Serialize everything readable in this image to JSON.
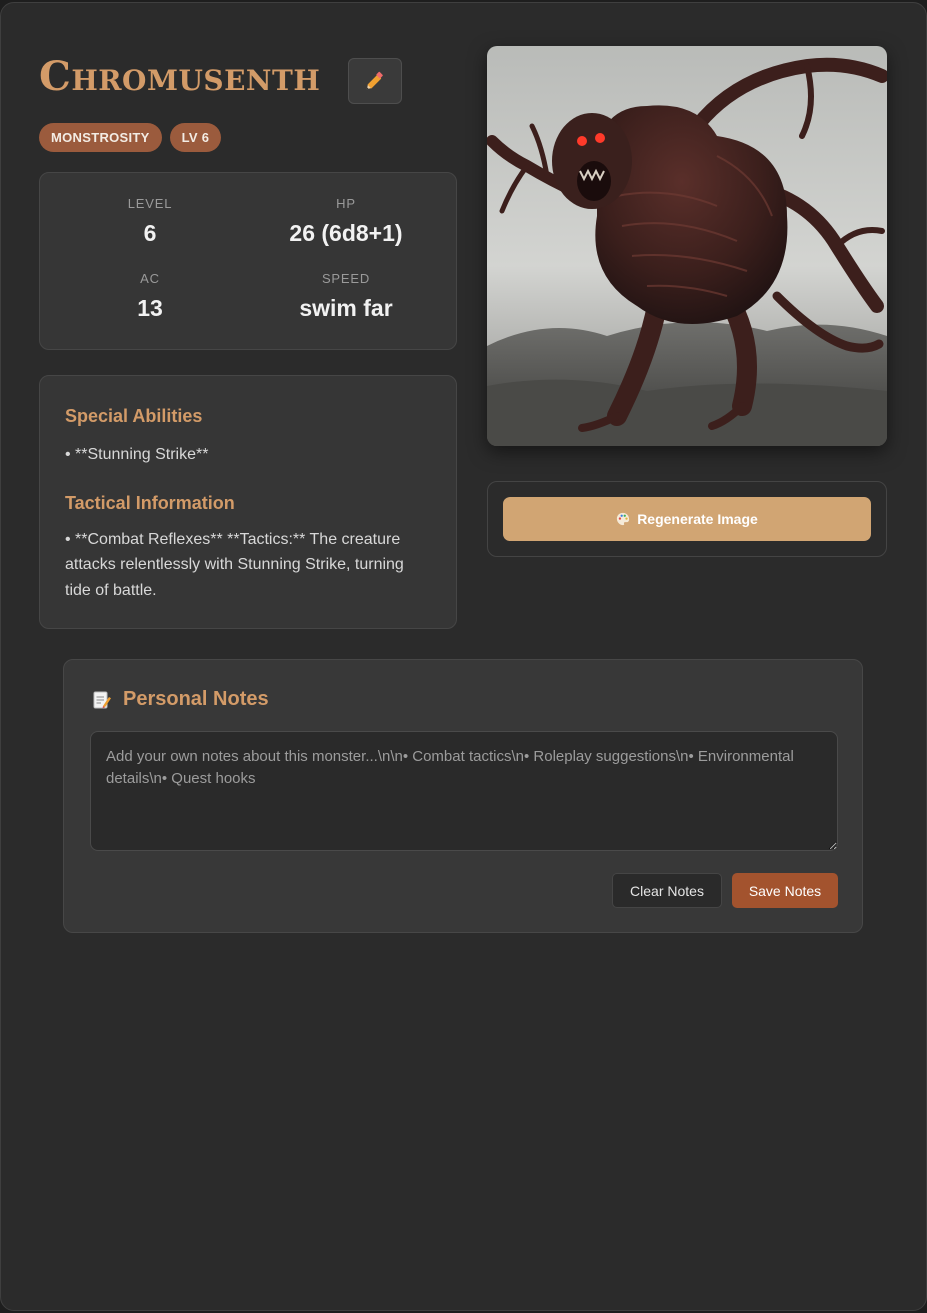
{
  "monster": {
    "name": "Chromusenth",
    "tags": [
      "MONSTROSITY",
      "LV 6"
    ]
  },
  "stats": {
    "level_label": "LEVEL",
    "level": "6",
    "hp_label": "HP",
    "hp": "26 (6d8+1)",
    "ac_label": "AC",
    "ac": "13",
    "speed_label": "SPEED",
    "speed": "swim far"
  },
  "details": {
    "abilities_heading": "Special Abilities",
    "abilities_text": "• **Stunning Strike**",
    "tactics_heading": "Tactical Information",
    "tactics_text": "• **Combat Reflexes** **Tactics:** The creature attacks relentlessly with Stunning Strike, turning tide of battle."
  },
  "image_panel": {
    "regenerate_label": "Regenerate Image",
    "regenerate_icon": "palette-icon"
  },
  "notes": {
    "heading": "Personal Notes",
    "heading_icon": "memo-icon",
    "value": "",
    "placeholder": "Add your own notes about this monster...\\n\\n• Combat tactics\\n• Roleplay suggestions\\n• Environmental details\\n• Quest hooks",
    "clear_label": "Clear Notes",
    "save_label": "Save Notes"
  },
  "colors": {
    "accent": "#d39b68",
    "badge": "#9b5b3d",
    "regenerate_button": "#d1a573",
    "save_button": "#a3532e",
    "panel": "#363636",
    "background": "#2b2b2b"
  }
}
